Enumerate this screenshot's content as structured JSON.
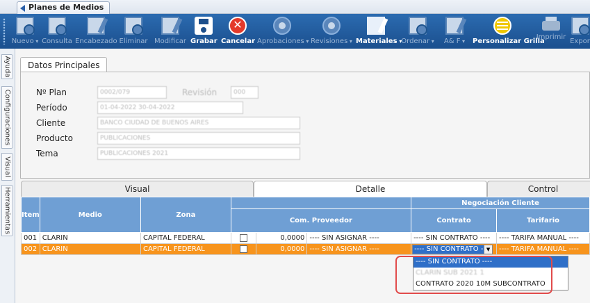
{
  "tab": {
    "title": "Planes de Medios"
  },
  "toolbar": {
    "nuevo": "Nuevo",
    "consulta": "Consulta",
    "encabezado": "Encabezado",
    "eliminar": "Eliminar",
    "modificar": "Modificar",
    "grabar": "Grabar",
    "cancelar": "Cancelar",
    "aprobaciones": "Aprobaciones",
    "revisiones": "Revisiones",
    "materiales": "Materiales",
    "ordenar": "Ordenar",
    "af": "A& F",
    "personalizar": "Personalizar Grilla",
    "imprimir": "Imprimir",
    "exportar": "Expor"
  },
  "sidebar": {
    "items": [
      "Ayuda",
      "Configuraciones",
      "Visual",
      "Herramientas"
    ]
  },
  "datos": {
    "tab_label": "Datos Principales",
    "plan_label": "Nº Plan",
    "plan_value": "0002/079",
    "revision_label": "Revisión",
    "revision_value": "000",
    "periodo_label": "Período",
    "periodo_value": "01-04-2022    30-04-2022",
    "cliente_label": "Cliente",
    "cliente_value": "BANCO CIUDAD DE BUENOS AIRES",
    "producto_label": "Producto",
    "producto_value": "PUBLICACIONES",
    "tema_label": "Tema",
    "tema_value": "PUBLICACIONES 2021"
  },
  "lower_tabs": [
    "Visual",
    "Detalle",
    "Control"
  ],
  "grid": {
    "group_header": "Negociación Cliente",
    "headers": {
      "item": "Item",
      "medio": "Medio",
      "zona": "Zona",
      "com": "Com. Proveedor",
      "contrato": "Contrato",
      "tarifario": "Tarifario"
    },
    "rows": [
      {
        "item": "001",
        "medio": "CLARIN",
        "zona": "CAPITAL FEDERAL",
        "com_val": "0,0000",
        "com_text": "---- SIN ASIGNAR ----",
        "contrato": "---- SIN CONTRATO ----",
        "tarifario": "---- TARIFA MANUAL ----"
      },
      {
        "item": "002",
        "medio": "CLARIN",
        "zona": "CAPITAL FEDERAL",
        "com_val": "0,0000",
        "com_text": "---- SIN ASIGNAR ----",
        "contrato": "---- SIN CONTRATO ----",
        "tarifario": "---- TARIFA MANUAL ----"
      }
    ]
  },
  "dropdown": {
    "options": [
      "---- SIN CONTRATO ----",
      "CLARIN SUB 2021 1",
      "CONTRATO 2020 10M  SUBCONTRATO"
    ]
  },
  "colors": {
    "toolbar": "#1f5a9c",
    "grid_header": "#6f9fd4",
    "selected_row": "#f7941d",
    "highlight": "#e14b4b"
  }
}
